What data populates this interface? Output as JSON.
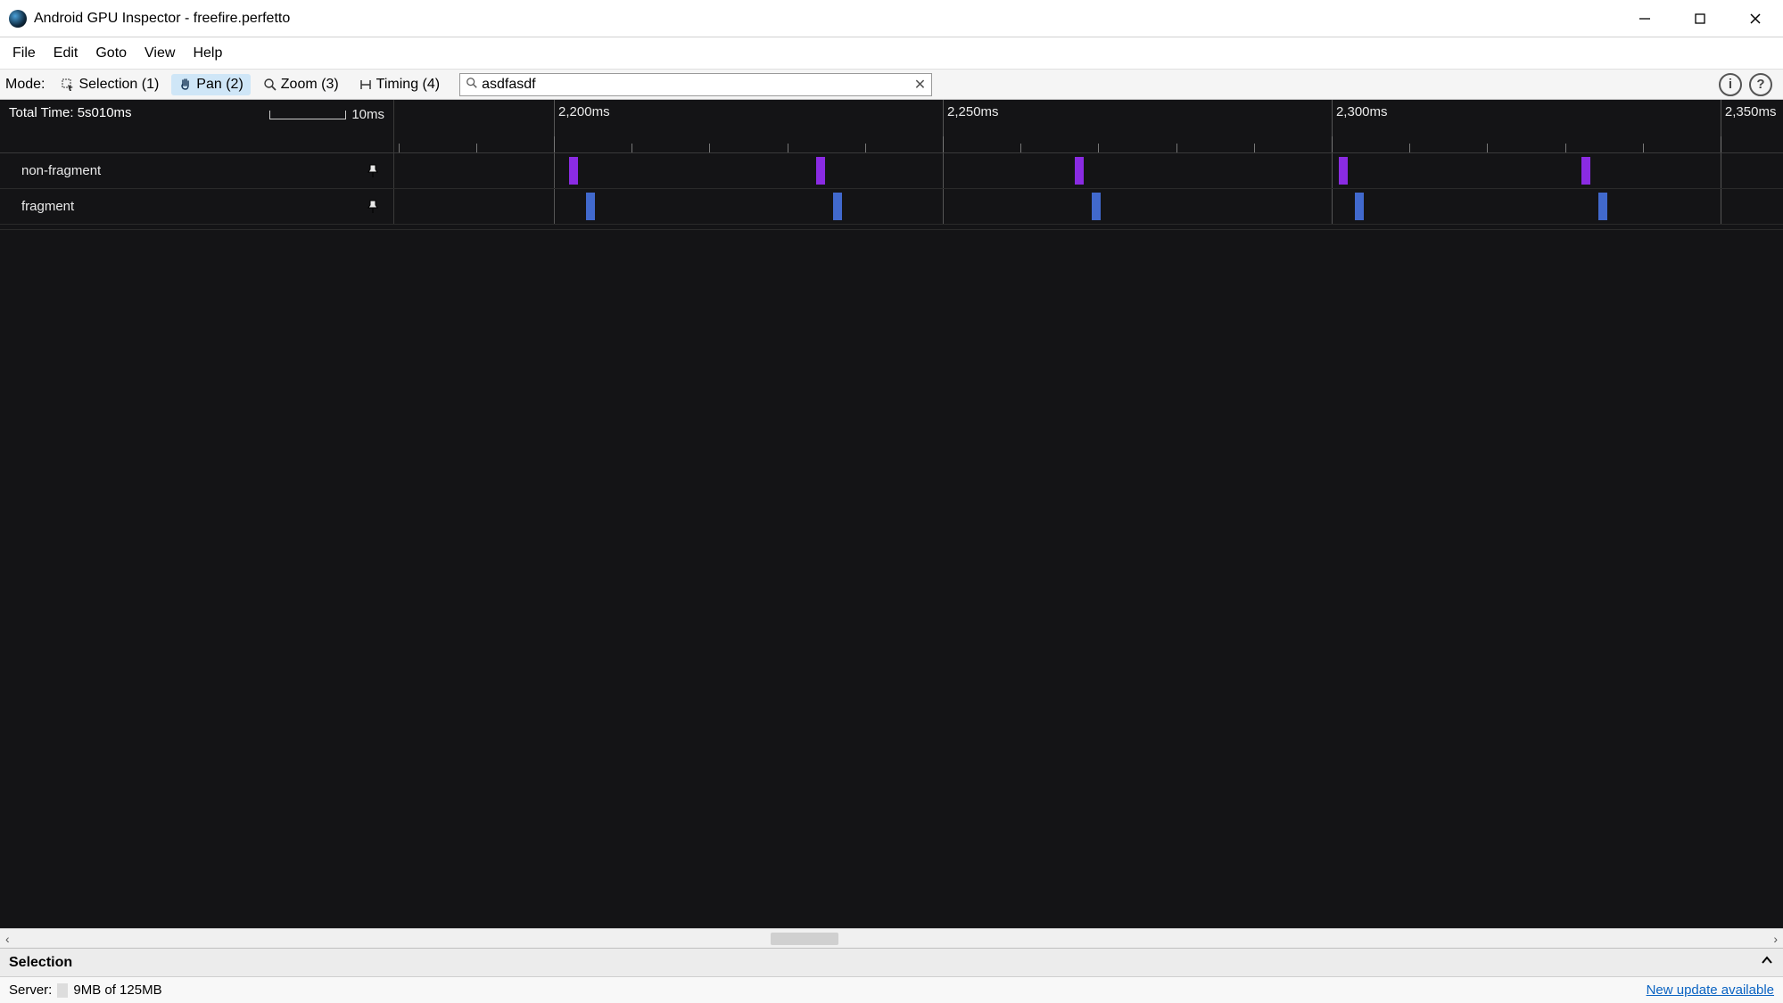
{
  "window": {
    "title": "Android GPU Inspector - freefire.perfetto"
  },
  "menu": {
    "file": "File",
    "edit": "Edit",
    "goto": "Goto",
    "view": "View",
    "help": "Help"
  },
  "toolbar": {
    "mode_label": "Mode:",
    "selection": "Selection (1)",
    "pan": "Pan (2)",
    "zoom": "Zoom (3)",
    "timing": "Timing (4)",
    "search_value": "asdfasdf",
    "info_tooltip": "i",
    "help_tooltip": "?"
  },
  "timeline": {
    "total_time_label": "Total Time: 5s010ms",
    "scale_label": "10ms",
    "major_labels": [
      "2,200ms",
      "2,250ms",
      "2,300ms",
      "2,350ms"
    ],
    "major_positions_pct": [
      11.5,
      39.5,
      67.5,
      95.5
    ],
    "tracks": [
      {
        "name": "non-fragment",
        "pinned": true,
        "color": "purple",
        "events_pct": [
          12.6,
          30.4,
          49.0,
          68.0,
          85.5,
          104.0
        ]
      },
      {
        "name": "fragment",
        "pinned": true,
        "color": "blue",
        "events_pct": [
          13.8,
          31.6,
          50.2,
          69.2,
          86.7,
          105.2
        ]
      }
    ]
  },
  "hscroll": {
    "thumb_left_pct": 43.2,
    "thumb_width_pct": 3.8
  },
  "selection_panel": {
    "title": "Selection"
  },
  "status": {
    "server_label": "Server:",
    "memory": "9MB of 125MB",
    "update_link": "New update available"
  }
}
